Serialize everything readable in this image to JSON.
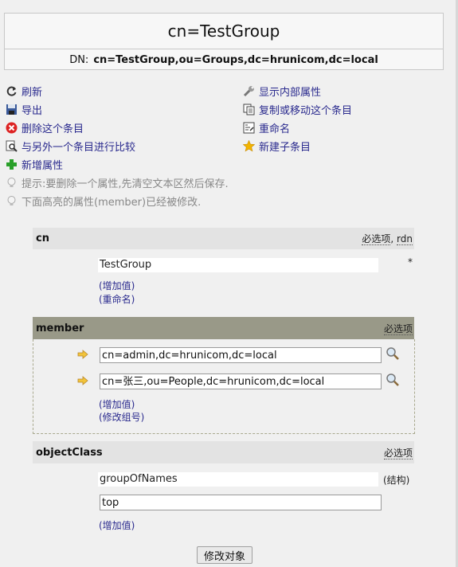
{
  "header": {
    "title": "cn=TestGroup",
    "dn_label": "DN:",
    "dn_value": "cn=TestGroup,ou=Groups,dc=hrunicom,dc=local"
  },
  "actions": {
    "refresh": "刷新",
    "export": "导出",
    "delete": "删除这个条目",
    "compare": "与另外一个条目进行比较",
    "add_attr": "新增属性",
    "show_internal": "显示内部属性",
    "copy_move": "复制或移动这个条目",
    "rename": "重命名",
    "new_child": "新建子条目",
    "hint1": "提示:要删除一个属性,先清空文本区然后保存.",
    "hint2": "下面高亮的属性(member)已经被修改."
  },
  "attrs": {
    "cn": {
      "name": "cn",
      "required": "必选项",
      "sep": ",",
      "rdn": "rdn",
      "value": "TestGroup",
      "asterisk": "*",
      "add_value": "(增加值)",
      "rename": "(重命名)"
    },
    "member": {
      "name": "member",
      "required": "必选项",
      "values": [
        "cn=admin,dc=hrunicom,dc=local",
        "cn=张三,ou=People,dc=hrunicom,dc=local"
      ],
      "add_value": "(增加值)",
      "modify_group": "(修改组号)"
    },
    "objectClass": {
      "name": "objectClass",
      "required": "必选项",
      "value1": "groupOfNames",
      "structural": "(结构)",
      "value2": "top",
      "add_value": "(增加值)"
    }
  },
  "submit_label": "修改对象",
  "colors": {
    "link": "#2a2a8e",
    "attr_header": "#e3e3e3",
    "modified_header": "#999988",
    "hint": "#888888"
  }
}
